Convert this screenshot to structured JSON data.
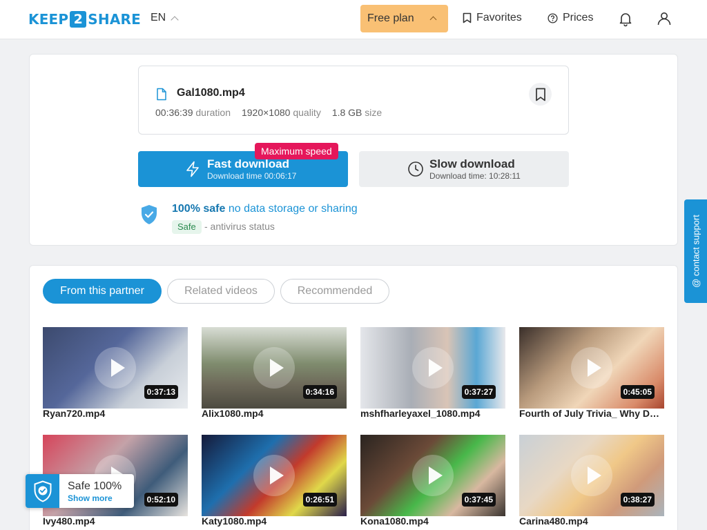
{
  "header": {
    "logo": {
      "left": "KEEP",
      "mid": "2",
      "right": "SHARE"
    },
    "lang": "EN",
    "plan": "Free plan",
    "favorites": "Favorites",
    "prices": "Prices",
    "icons": {
      "bell": "bell-icon",
      "user": "user-icon"
    }
  },
  "file": {
    "name": "Gal1080.mp4",
    "duration_value": "00:36:39",
    "duration_label": "duration",
    "quality_value": "1920×1080",
    "quality_label": "quality",
    "size_value": "1.8 GB",
    "size_label": "size"
  },
  "download": {
    "fast_title": "Fast download",
    "fast_sub": "Download time 00:06:17",
    "badge": "Maximum speed",
    "slow_title": "Slow download",
    "slow_sub": "Download time: 10:28:11"
  },
  "safety": {
    "strong": "100% safe",
    "rest": "no data storage or sharing",
    "tag": "Safe",
    "status": "- antivirus status"
  },
  "tabs": [
    "From this partner",
    "Related videos",
    "Recommended"
  ],
  "videos": [
    {
      "name": "Ryan720.mp4",
      "duration": "0:37:13"
    },
    {
      "name": "Alix1080.mp4",
      "duration": "0:34:16"
    },
    {
      "name": "mshfharleyaxel_1080.mp4",
      "duration": "0:37:27"
    },
    {
      "name": "Fourth of July Trivia_ Why Do You Know",
      "duration": "0:45:05"
    },
    {
      "name": "Ivy480.mp4",
      "duration": "0:52:10"
    },
    {
      "name": "Katy1080.mp4",
      "duration": "0:26:51"
    },
    {
      "name": "Kona1080.mp4",
      "duration": "0:37:45"
    },
    {
      "name": "Carina480.mp4",
      "duration": "0:38:27"
    }
  ],
  "support": "@ contact support",
  "widget": {
    "title": "Safe 100%",
    "link": "Show more"
  },
  "colors": {
    "accent": "#1b93d6",
    "plan": "#f9c074",
    "badge": "#e5175b"
  }
}
